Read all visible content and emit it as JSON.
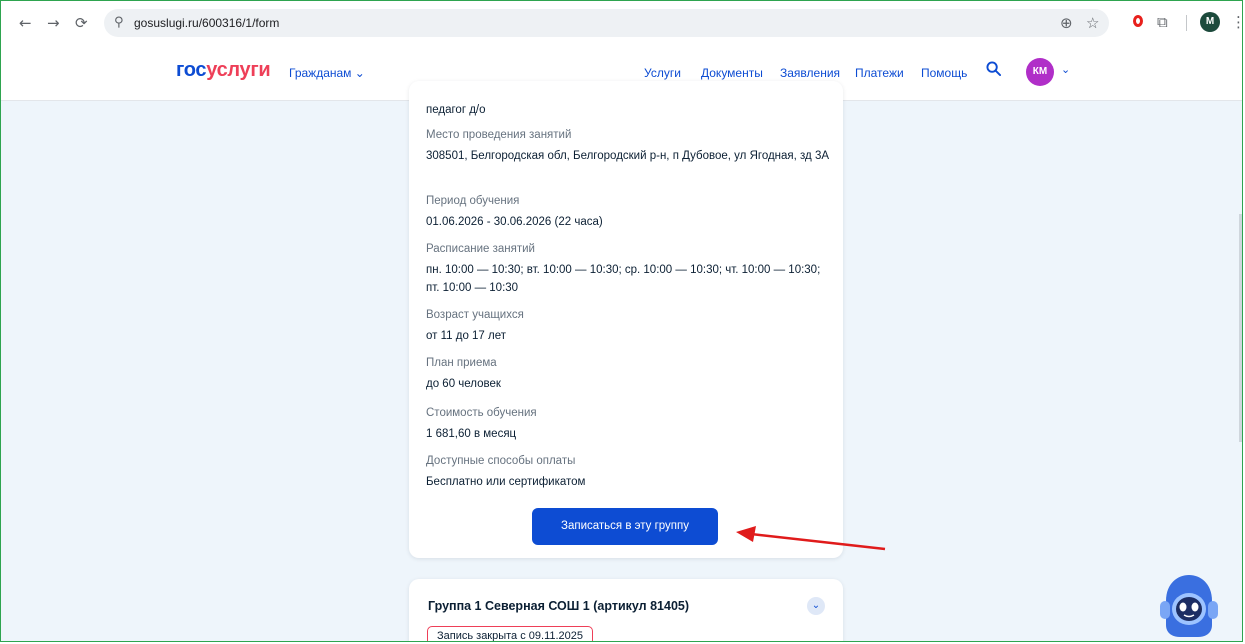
{
  "browser": {
    "back": "←",
    "forward": "→",
    "reload": "⟳",
    "tune": "⚲",
    "url": "gosuslugi.ru/600316/1/form",
    "zoom_icon": "⊕",
    "star_icon": "☆",
    "ext_icon": "⧉",
    "menu_icon": "⋮",
    "profile_initial": "M"
  },
  "header": {
    "logo_part1": "гос",
    "logo_part2": "услуги",
    "citizens": "Гражданам",
    "citizens_chevron": "⌄",
    "nav": [
      "Услуги",
      "Документы",
      "Заявления",
      "Платежи",
      "Помощь"
    ],
    "avatar_initials": "КМ",
    "avatar_chevron": "⌄"
  },
  "group_details": {
    "teacher_value": "педагог д/о",
    "fields": [
      {
        "label": "Место проведения занятий",
        "value": "308501, Белгородская обл, Белгородский р-н, п Дубовое, ул Ягодная, зд 3А"
      },
      {
        "label": "Период обучения",
        "value": "01.06.2026 - 30.06.2026 (22 часа)"
      },
      {
        "label": "Расписание занятий",
        "value": "пн. 10:00 — 10:30; вт. 10:00 — 10:30; ср. 10:00 — 10:30; чт. 10:00 — 10:30; пт. 10:00 — 10:30"
      },
      {
        "label": "Возраст учащихся",
        "value": "от 11 до 17 лет"
      },
      {
        "label": "План приема",
        "value": "до 60 человек"
      },
      {
        "label": "Стоимость обучения",
        "value": "1 681,60 в месяц"
      },
      {
        "label": "Доступные способы оплаты",
        "value": "Бесплатно или сертификатом"
      }
    ],
    "enroll_button": "Записаться в эту группу"
  },
  "next_group": {
    "title": "Группа 1 Северная СОШ 1 (артикул 81405)",
    "chevron": "⌄",
    "badge": "Запись закрыта с 09.11.2025"
  },
  "colors": {
    "accent": "#0d4cd3",
    "logo_red": "#ee3f58",
    "avatar": "#b02ec8",
    "annotation_arrow": "#e01b1b"
  }
}
